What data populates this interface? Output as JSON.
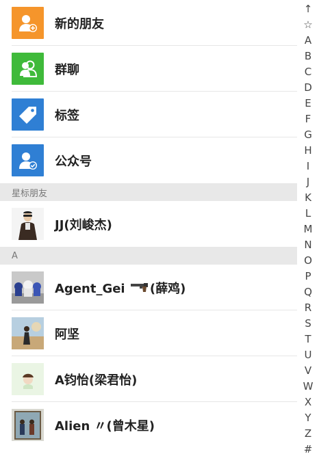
{
  "top_entries": [
    {
      "label": "新的朋友",
      "icon": "add-friend-icon",
      "color": "#f5952b"
    },
    {
      "label": "群聊",
      "icon": "group-chat-icon",
      "color": "#3fba3a"
    },
    {
      "label": "标签",
      "icon": "tag-icon",
      "color": "#2f7fd4"
    },
    {
      "label": "公众号",
      "icon": "official-account-icon",
      "color": "#2f7fd4"
    }
  ],
  "sections": {
    "starred": "星标朋友",
    "a": "A"
  },
  "starred_contacts": [
    {
      "name": "JJ(刘峻杰)"
    }
  ],
  "a_contacts": [
    {
      "name_prefix": "Agent_Gei ",
      "emoji": "pistol-emoji",
      "name_suffix": "(薛鸡)"
    },
    {
      "name": "阿坚"
    },
    {
      "name": "A钧怡(梁君怡)"
    },
    {
      "name": "Alien 〃(曾木星)"
    }
  ],
  "index_letters": [
    "↑",
    "☆",
    "A",
    "B",
    "C",
    "D",
    "E",
    "F",
    "G",
    "H",
    "I",
    "J",
    "K",
    "L",
    "M",
    "N",
    "O",
    "P",
    "Q",
    "R",
    "S",
    "T",
    "U",
    "V",
    "W",
    "X",
    "Y",
    "Z",
    "#"
  ]
}
